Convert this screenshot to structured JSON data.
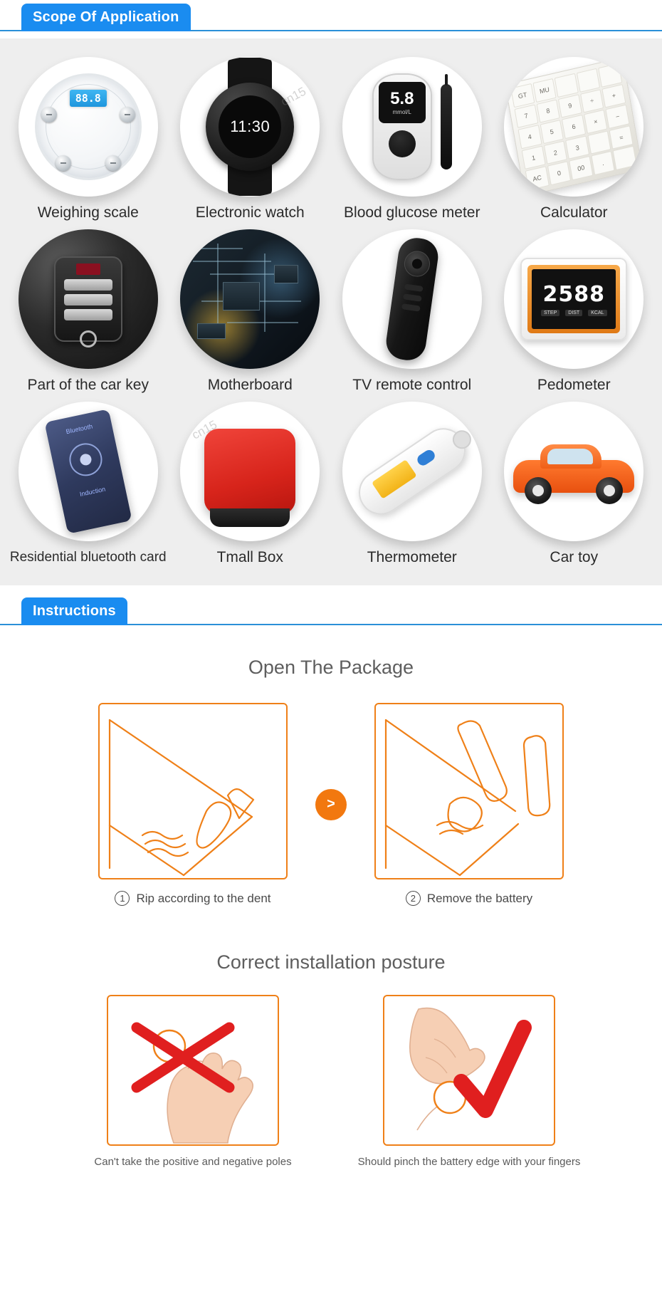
{
  "sections": {
    "scope": {
      "tab_label": "Scope Of Application",
      "items": [
        {
          "label": "Weighing scale",
          "icon": "weighing-scale-icon",
          "display": "88.8"
        },
        {
          "label": "Electronic watch",
          "icon": "smart-watch-icon",
          "display": "11:30"
        },
        {
          "label": "Blood glucose meter",
          "icon": "glucose-meter-icon",
          "display": "5.8",
          "unit": "mmol/L"
        },
        {
          "label": "Calculator",
          "icon": "calculator-icon",
          "display": ""
        },
        {
          "label": "Part of the car key",
          "icon": "car-key-fob-icon",
          "display": ""
        },
        {
          "label": "Motherboard",
          "icon": "motherboard-icon",
          "display": ""
        },
        {
          "label": "TV remote control",
          "icon": "tv-remote-icon",
          "display": ""
        },
        {
          "label": "Pedometer",
          "icon": "pedometer-icon",
          "display": "2588",
          "sub": [
            "STEP",
            "DIST",
            "KCAL"
          ]
        },
        {
          "label": "Residential bluetooth card",
          "icon": "bluetooth-card-icon",
          "display": "Bluetooth",
          "sub_text": "Induction"
        },
        {
          "label": "Tmall Box",
          "icon": "tmall-box-icon",
          "display": ""
        },
        {
          "label": "Thermometer",
          "icon": "infrared-thermometer-icon",
          "display": ""
        },
        {
          "label": "Car toy",
          "icon": "toy-car-icon",
          "display": ""
        }
      ],
      "watermark": "cn15"
    },
    "instructions": {
      "tab_label": "Instructions",
      "open_package": {
        "heading": "Open The Package",
        "arrow_glyph": ">",
        "steps": [
          {
            "number": "①",
            "caption": "Rip according to the dent",
            "illustration": "rip-dent-illustration"
          },
          {
            "number": "②",
            "caption": "Remove the battery",
            "illustration": "remove-battery-illustration"
          }
        ]
      },
      "posture": {
        "heading": "Correct installation posture",
        "items": [
          {
            "caption": "Can't take the positive and negative poles",
            "mark": "cross-mark-icon",
            "mark_color": "#e01f1f"
          },
          {
            "caption": "Should pinch the battery edge with your fingers",
            "mark": "check-mark-icon",
            "mark_color": "#e01f1f"
          }
        ]
      }
    }
  },
  "colors": {
    "tab_blue": "#1a8cf0",
    "rule_blue": "#2a90d8",
    "panel_gray": "#eeeeee",
    "orange": "#ef8018",
    "arrow_orange": "#f2780f",
    "mark_red": "#e01f1f"
  }
}
